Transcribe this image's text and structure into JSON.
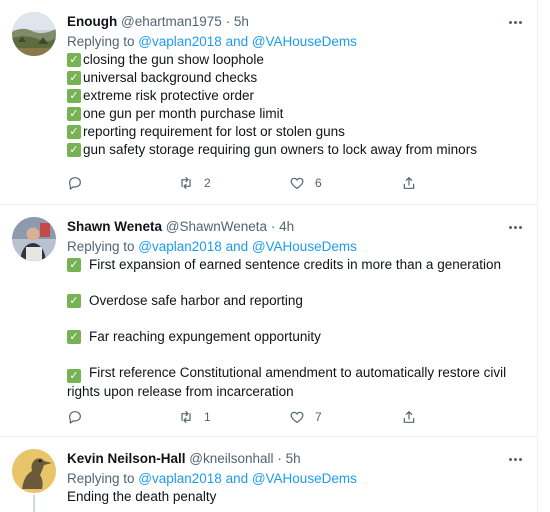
{
  "tweets": [
    {
      "name": "Enough",
      "handle": "@ehartman1975",
      "dot": "·",
      "time": "5h",
      "replying_prefix": "Replying to ",
      "replying_to": "@vaplan2018 and @VAHouseDems",
      "lines": [
        " closing the gun show loophole",
        "universal background checks",
        "extreme risk protective order",
        "one gun per month purchase limit",
        "reporting requirement for lost or stolen guns",
        "gun safety storage requiring gun owners to lock away from minors"
      ],
      "replies": "",
      "retweets": "2",
      "likes": "6"
    },
    {
      "name": "Shawn Weneta",
      "handle": "@ShawnWeneta",
      "dot": "·",
      "time": "4h",
      "replying_prefix": "Replying to ",
      "replying_to": "@vaplan2018 and @VAHouseDems",
      "lines": [
        "First expansion of earned sentence credits in more than a generation",
        "Overdose safe harbor and reporting",
        "Far reaching expungement opportunity",
        "First reference Constitutional amendment to automatically restore civil rights upon release from incarceration"
      ],
      "replies": "",
      "retweets": "1",
      "likes": "7"
    },
    {
      "name": "Kevin Neilson-Hall",
      "handle": "@kneilsonhall",
      "dot": "·",
      "time": "5h",
      "replying_prefix": "Replying to ",
      "replying_to": "@vaplan2018 and @VAHouseDems",
      "lines": [
        "Ending the death penalty"
      ]
    }
  ],
  "icons": {
    "check": "white-heavy-check-mark-emoji",
    "reply": "reply-icon",
    "retweet": "retweet-icon",
    "like": "heart-icon",
    "share": "share-icon",
    "more": "more-dots-icon"
  },
  "colors": {
    "link": "#1d9bf0",
    "secondary_text": "#536471",
    "check_green": "#77b255"
  }
}
